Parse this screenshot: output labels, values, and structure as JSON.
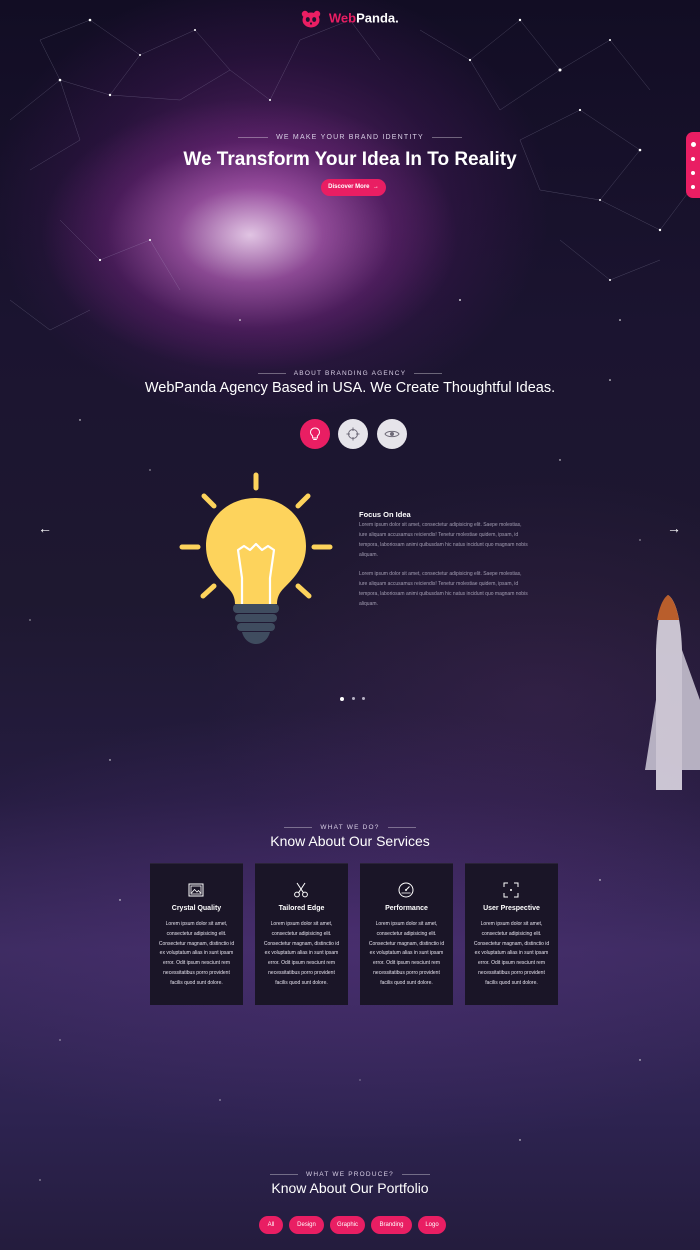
{
  "brand": {
    "part1": "Web",
    "part2": "Panda."
  },
  "hero": {
    "eyebrow": "WE MAKE YOUR BRAND IDENTITY",
    "title": "We Transform Your Idea In To Reality",
    "button": "Discover More"
  },
  "about": {
    "eyebrow": "ABOUT BRANDING AGENCY",
    "title": "WebPanda Agency Based in USA. We Create Thoughtful Ideas.",
    "tabs": [
      {
        "icon": "lightbulb-icon",
        "active": true
      },
      {
        "icon": "crosshair-icon",
        "active": false
      },
      {
        "icon": "eye-icon",
        "active": false
      }
    ],
    "slide": {
      "title": "Focus On Idea",
      "p1": [
        "Lorem ipsum dolor sit amet, consectetur adipisicing elit. Saepe molestias,",
        "iure aliquam accusamus reiciendis! Tenetur molestiae quidem, ipsam, id",
        "tempora, laboriosam animi quibusdam hic natus incidunt quo magnam nobis",
        "aliquam."
      ],
      "p2": [
        "Lorem ipsum dolor sit amet, consectetur adipisicing elit. Saepe molestias,",
        "iure aliquam accusamus reiciendis! Tenetur molestiae quidem, ipsam, id",
        "tempora, laboriosam animi quibusdam hic natus incidunt quo magnam nobis",
        "aliquam."
      ]
    },
    "pager": {
      "count": 3,
      "active": 1
    }
  },
  "services": {
    "eyebrow": "WHAT WE DO?",
    "title": "Know About Our Services",
    "cards": [
      {
        "icon": "image-icon",
        "title": "Crystal Quality",
        "lines": [
          "Lorem ipsum dolor sit amet,",
          "consectetur adipisicing elit.",
          "Consectetur magnam, distinctio id",
          "ex voluptatum alias in sunt ipsam",
          "error. Odit ipsum nesciunt rem",
          "necessitatibus porro provident",
          "facilis quod sunt dolore."
        ]
      },
      {
        "icon": "scissors-icon",
        "title": "Tailored Edge",
        "lines": [
          "Lorem ipsum dolor sit amet,",
          "consectetur adipisicing elit.",
          "Consectetur magnam, distinctio id",
          "ex voluptatum alias in sunt ipsam",
          "error. Odit ipsum nesciunt rem",
          "necessitatibus porro provident",
          "facilis quod sunt dolore."
        ]
      },
      {
        "icon": "gauge-icon",
        "title": "Performance",
        "lines": [
          "Lorem ipsum dolor sit amet,",
          "consectetur adipisicing elit.",
          "Consectetur magnam, distinctio id",
          "ex voluptatum alias in sunt ipsam",
          "error. Odit ipsum nesciunt rem",
          "necessitatibus porro provident",
          "facilis quod sunt dolore."
        ]
      },
      {
        "icon": "focus-frame-icon",
        "title": "User Prespective",
        "lines": [
          "Lorem ipsum dolor sit amet,",
          "consectetur adipisicing elit.",
          "Consectetur magnam, distinctio id",
          "ex voluptatum alias in sunt ipsam",
          "error. Odit ipsum nesciunt rem",
          "necessitatibus porro provident",
          "facilis quod sunt dolore."
        ]
      }
    ]
  },
  "portfolio": {
    "eyebrow": "WHAT WE PRODUCE?",
    "title": "Know About Our Portfolio",
    "filters": [
      "All",
      "Design",
      "Graphic",
      "Branding",
      "Logo"
    ]
  },
  "colors": {
    "accent": "#e91e63",
    "bulb": "#fdd35c",
    "bulb_base": "#3f4c5f"
  }
}
